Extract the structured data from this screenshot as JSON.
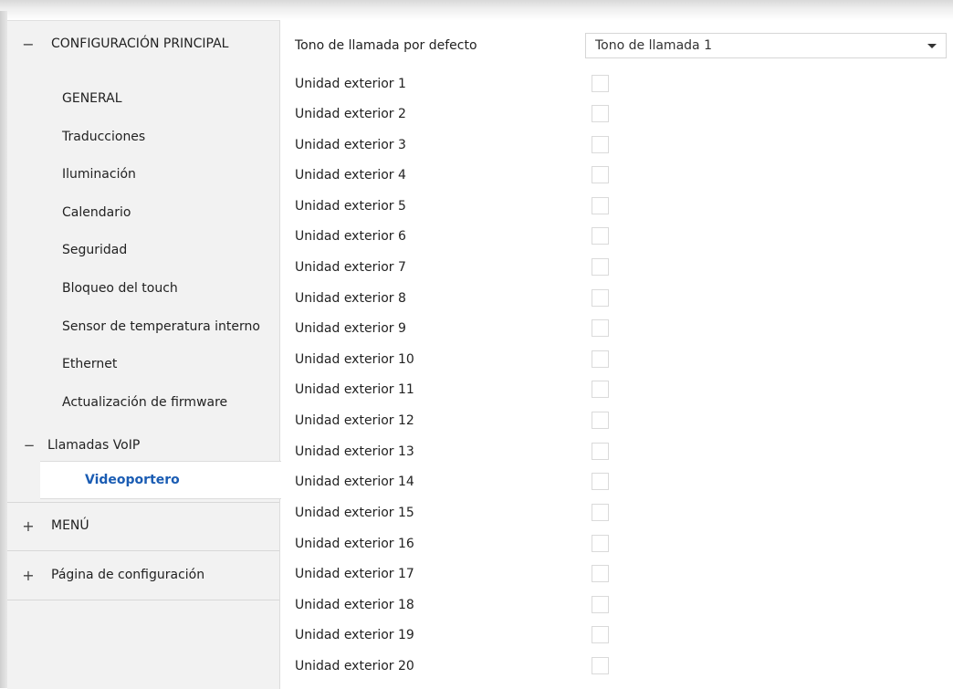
{
  "sidebar": {
    "main_section": {
      "sign": "−",
      "label": "CONFIGURACIÓN PRINCIPAL"
    },
    "items": [
      {
        "label": "GENERAL"
      },
      {
        "label": "Traducciones"
      },
      {
        "label": "Iluminación"
      },
      {
        "label": "Calendario"
      },
      {
        "label": "Seguridad"
      },
      {
        "label": "Bloqueo del touch"
      },
      {
        "label": "Sensor de temperatura interno"
      },
      {
        "label": "Ethernet"
      },
      {
        "label": "Actualización de firmware"
      }
    ],
    "voip": {
      "sign": "−",
      "label": "Llamadas VoIP"
    },
    "active_item": {
      "label": "Videoportero"
    },
    "menu_section": {
      "sign": "+",
      "label": "MENÚ"
    },
    "config_page_section": {
      "sign": "+",
      "label": "Página de configuración"
    }
  },
  "content": {
    "ringtone": {
      "label": "Tono de llamada por defecto",
      "value": "Tono de llamada 1"
    },
    "units": [
      {
        "label": "Unidad exterior 1",
        "checked": false
      },
      {
        "label": "Unidad exterior 2",
        "checked": false
      },
      {
        "label": "Unidad exterior 3",
        "checked": false
      },
      {
        "label": "Unidad exterior 4",
        "checked": false
      },
      {
        "label": "Unidad exterior 5",
        "checked": false
      },
      {
        "label": "Unidad exterior 6",
        "checked": false
      },
      {
        "label": "Unidad exterior 7",
        "checked": false
      },
      {
        "label": "Unidad exterior 8",
        "checked": false
      },
      {
        "label": "Unidad exterior 9",
        "checked": false
      },
      {
        "label": "Unidad exterior 10",
        "checked": false
      },
      {
        "label": "Unidad exterior 11",
        "checked": false
      },
      {
        "label": "Unidad exterior 12",
        "checked": false
      },
      {
        "label": "Unidad exterior 13",
        "checked": false
      },
      {
        "label": "Unidad exterior 14",
        "checked": false
      },
      {
        "label": "Unidad exterior 15",
        "checked": false
      },
      {
        "label": "Unidad exterior 16",
        "checked": false
      },
      {
        "label": "Unidad exterior 17",
        "checked": false
      },
      {
        "label": "Unidad exterior 18",
        "checked": false
      },
      {
        "label": "Unidad exterior 19",
        "checked": false
      },
      {
        "label": "Unidad exterior 20",
        "checked": false
      }
    ]
  },
  "colors": {
    "accent": "#1a5cb3",
    "sidebar_bg": "#f2f2f2",
    "border": "#dadada"
  }
}
